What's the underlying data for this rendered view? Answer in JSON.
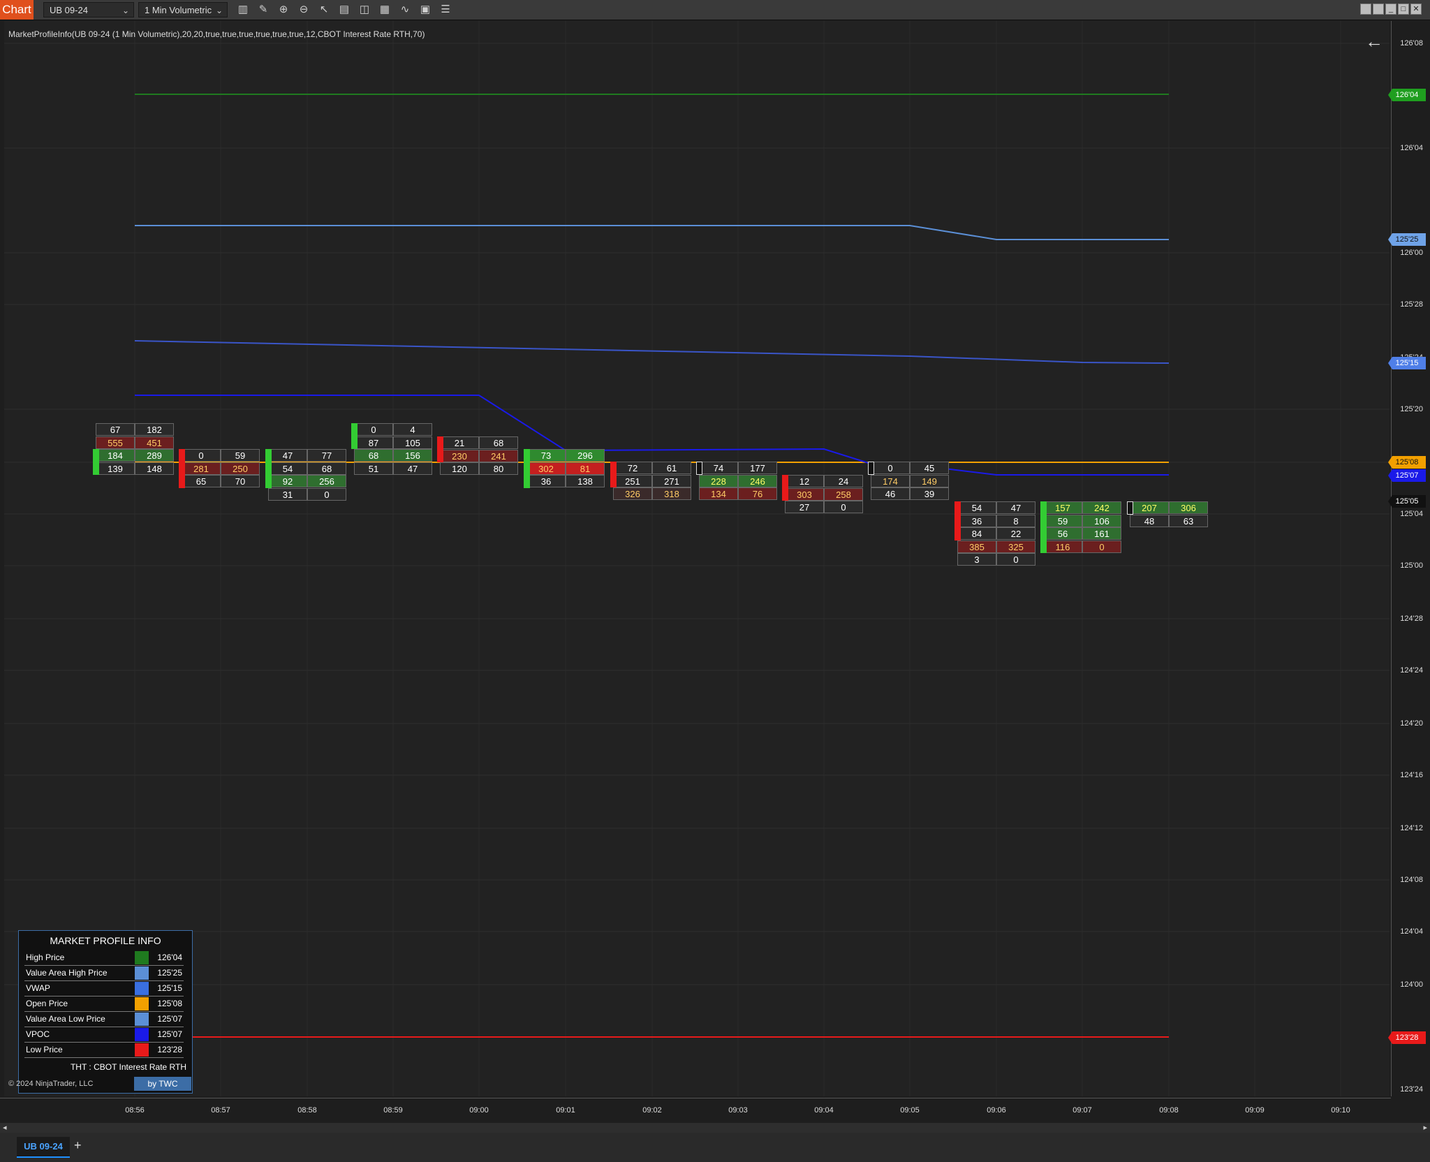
{
  "toolbar": {
    "chart_tab": "Chart",
    "instrument": "UB 09-24",
    "timeframe": "1 Min Volumetric",
    "tools": [
      {
        "name": "bars-icon",
        "glyph": "▥"
      },
      {
        "name": "pencil-icon",
        "glyph": "✎"
      },
      {
        "name": "zoom-in-icon",
        "glyph": "⊕"
      },
      {
        "name": "zoom-out-icon",
        "glyph": "⊖"
      },
      {
        "name": "pointer-icon",
        "glyph": "↖"
      },
      {
        "name": "template-icon",
        "glyph": "▤"
      },
      {
        "name": "split-icon",
        "glyph": "◫"
      },
      {
        "name": "chart-style-icon",
        "glyph": "▦"
      },
      {
        "name": "indicators-icon",
        "glyph": "∿"
      },
      {
        "name": "strategies-icon",
        "glyph": "▣"
      },
      {
        "name": "list-icon",
        "glyph": "☰"
      }
    ]
  },
  "indicator_label": "MarketProfileInfo(UB 09-24 (1 Min Volumetric),20,20,true,true,true,true,true,true,12,CBOT Interest Rate RTH,70)",
  "price_axis": {
    "ticks": [
      "126'08",
      "126'04",
      "126'00",
      "125'28",
      "125'24",
      "125'20",
      "125'12",
      "125'04",
      "125'00",
      "124'28",
      "124'24",
      "124'20",
      "124'16",
      "124'12",
      "124'08",
      "124'04",
      "124'00",
      "123'24"
    ],
    "badges": [
      {
        "text": "126'04",
        "color": "#1f9e1f",
        "fg": "#ffffff"
      },
      {
        "text": "125'25",
        "color": "#6fa3e8",
        "fg": "#111111"
      },
      {
        "text": "125'15",
        "color": "#4f7fe8",
        "fg": "#ffffff"
      },
      {
        "text": "125'08",
        "color": "#f2a000",
        "fg": "#111111"
      },
      {
        "text": "125'07",
        "color": "#1a1ae8",
        "fg": "#ffffff"
      },
      {
        "text": "125'05",
        "color": "#111111",
        "fg": "#ffffff"
      },
      {
        "text": "123'28",
        "color": "#e81a1a",
        "fg": "#ffffff"
      }
    ]
  },
  "time_axis": [
    "08:56",
    "08:57",
    "08:58",
    "08:59",
    "09:00",
    "09:01",
    "09:02",
    "09:03",
    "09:04",
    "09:05",
    "09:06",
    "09:07",
    "09:08",
    "09:09",
    "09:10"
  ],
  "colors": {
    "high": "#1f7a1f",
    "vah": "#5b8fd6",
    "vwap": "#3a55c8",
    "open": "#f2a000",
    "val": "#1a1ae8",
    "vpoc": "#1a1ae8",
    "low": "#e81a1a"
  },
  "bars": [
    {
      "bar": 0,
      "cells": [
        [
          67,
          182
        ],
        [
          555,
          451
        ],
        [
          184,
          289
        ],
        [
          139,
          148
        ]
      ]
    },
    {
      "bar": 1,
      "cells": [
        [
          0,
          59
        ],
        [
          281,
          250
        ],
        [
          65,
          70
        ]
      ]
    },
    {
      "bar": 2,
      "cells": [
        [
          47,
          77
        ],
        [
          54,
          68
        ],
        [
          92,
          256
        ],
        [
          31,
          0
        ]
      ]
    },
    {
      "bar": 3,
      "cells": [
        [
          0,
          4
        ],
        [
          87,
          105
        ],
        [
          68,
          156
        ],
        [
          51,
          47
        ]
      ]
    },
    {
      "bar": 4,
      "cells": [
        [
          21,
          68
        ],
        [
          230,
          241
        ],
        [
          120,
          80
        ]
      ]
    },
    {
      "bar": 5,
      "cells": [
        [
          73,
          296
        ],
        [
          302,
          81
        ],
        [
          36,
          138
        ]
      ]
    },
    {
      "bar": 6,
      "cells": [
        [
          72,
          61
        ],
        [
          251,
          271
        ],
        [
          326,
          318
        ]
      ]
    },
    {
      "bar": 7,
      "cells": [
        [
          74,
          177
        ],
        [
          228,
          246
        ],
        [
          134,
          76
        ]
      ]
    },
    {
      "bar": 8,
      "cells": [
        [
          12,
          24
        ],
        [
          303,
          258
        ],
        [
          27,
          0
        ]
      ]
    },
    {
      "bar": 9,
      "cells": [
        [
          0,
          45
        ],
        [
          174,
          149
        ],
        [
          46,
          39
        ]
      ]
    },
    {
      "bar": 10,
      "cells": [
        [
          54,
          47
        ],
        [
          36,
          8
        ],
        [
          84,
          22
        ],
        [
          385,
          325
        ],
        [
          3,
          0
        ]
      ]
    },
    {
      "bar": 11,
      "cells": [
        [
          157,
          242
        ],
        [
          59,
          106
        ],
        [
          56,
          161
        ],
        [
          116,
          0
        ]
      ]
    },
    {
      "bar": 12,
      "cells": [
        [
          207,
          306
        ],
        [
          48,
          63
        ]
      ]
    }
  ],
  "panel": {
    "title": "MARKET PROFILE INFO",
    "rows": [
      {
        "label": "High Price",
        "color": "#1f7a1f",
        "value": "126'04"
      },
      {
        "label": "Value Area High Price",
        "color": "#5b8fd6",
        "value": "125'25"
      },
      {
        "label": "VWAP",
        "color": "#3a6fe0",
        "value": "125'15"
      },
      {
        "label": "Open Price",
        "color": "#f2a000",
        "value": "125'08"
      },
      {
        "label": "Value Area Low Price",
        "color": "#5b8fd6",
        "value": "125'07"
      },
      {
        "label": "VPOC",
        "color": "#1a1ae8",
        "value": "125'07"
      },
      {
        "label": "Low Price",
        "color": "#e81a1a",
        "value": "123'28"
      }
    ],
    "footer": "THT : CBOT Interest Rate RTH",
    "badge": "by TWC"
  },
  "copyright": "© 2024 NinjaTrader, LLC",
  "bottom_tab": {
    "label": "UB 09-24",
    "add": "+"
  }
}
